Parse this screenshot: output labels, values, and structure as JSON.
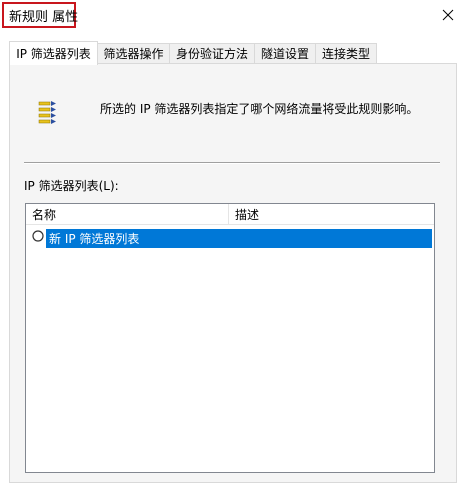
{
  "window": {
    "title": "新规则 属性",
    "close_icon": "close-icon"
  },
  "tabs": [
    {
      "label": "IP 筛选器列表",
      "active": true
    },
    {
      "label": "筛选器操作",
      "active": false
    },
    {
      "label": "身份验证方法",
      "active": false
    },
    {
      "label": "隧道设置",
      "active": false
    },
    {
      "label": "连接类型",
      "active": false
    }
  ],
  "panel": {
    "icon": "filter-rules-icon",
    "description": "所选的 IP 筛选器列表指定了哪个网络流量将受此规则影响。",
    "list_label": "IP 筛选器列表(L):",
    "columns": [
      "名称",
      "描述"
    ],
    "rows": [
      {
        "name": "新 IP 筛选器列表",
        "description": "",
        "selected": true
      }
    ]
  },
  "colors": {
    "title_highlight_border": "#c8161d",
    "selection": "#0078d7"
  }
}
